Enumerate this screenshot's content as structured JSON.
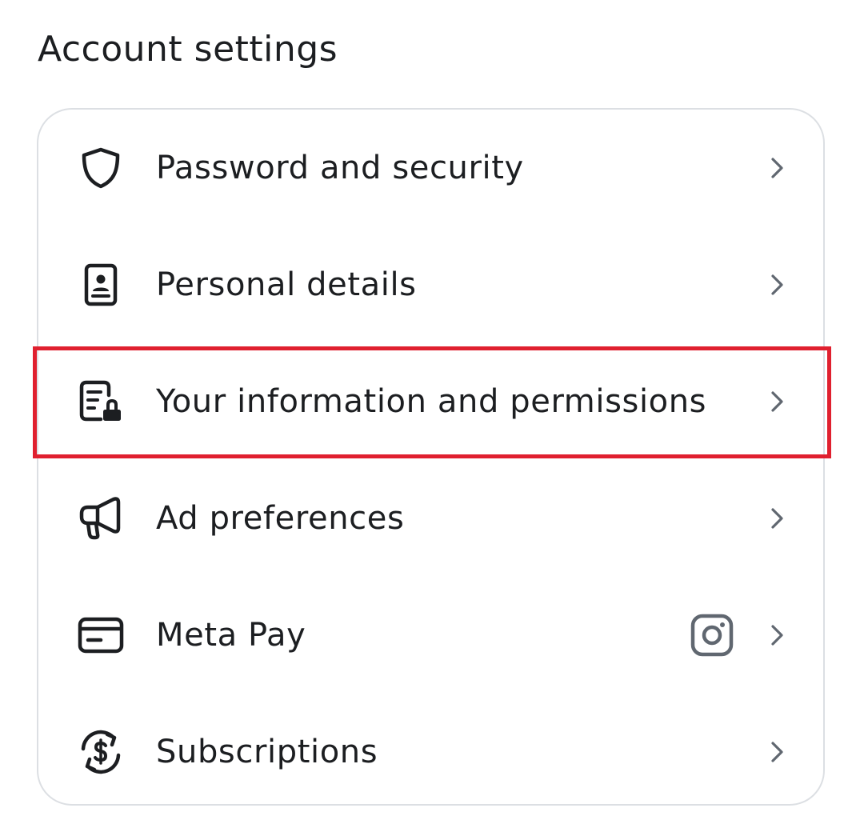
{
  "page": {
    "title": "Account settings"
  },
  "settings": {
    "items": [
      {
        "label": "Password and security",
        "icon": "shield-icon"
      },
      {
        "label": "Personal details",
        "icon": "id-card-icon"
      },
      {
        "label": "Your information and permissions",
        "icon": "document-lock-icon",
        "highlighted": true
      },
      {
        "label": "Ad preferences",
        "icon": "megaphone-icon"
      },
      {
        "label": "Meta Pay",
        "icon": "credit-card-icon",
        "badge_icon": "instagram-icon"
      },
      {
        "label": "Subscriptions",
        "icon": "dollar-refresh-icon"
      }
    ]
  },
  "colors": {
    "text": "#1c1e21",
    "chevron": "#606770",
    "card_border": "#dcdfe3",
    "highlight_border": "#e0202f"
  }
}
